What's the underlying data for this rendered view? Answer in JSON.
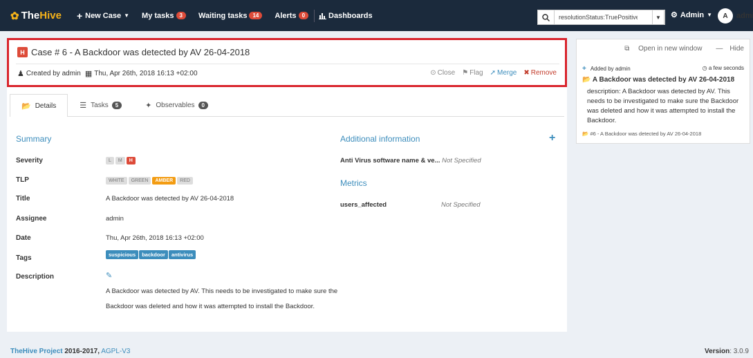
{
  "nav": {
    "brand_the": "The",
    "brand_hive": "Hive",
    "new_case": "New Case",
    "my_tasks": "My tasks",
    "my_tasks_count": "3",
    "waiting_tasks": "Waiting tasks",
    "waiting_tasks_count": "14",
    "alerts": "Alerts",
    "alerts_count": "0",
    "dashboards": "Dashboards",
    "search_value": "resolutionStatus:TruePositive",
    "admin": "Admin",
    "user_initial": "A",
    "user_name": "admin"
  },
  "case": {
    "severity_badge": "H",
    "title": "Case # 6 - A Backdoor was detected by AV 26-04-2018",
    "created_by": "Created by admin",
    "created_at": "Thu, Apr 26th, 2018 16:13 +02:00",
    "actions": {
      "close": "Close",
      "flag": "Flag",
      "merge": "Merge",
      "remove": "Remove"
    }
  },
  "tabs": [
    {
      "label": "Details"
    },
    {
      "label": "Tasks",
      "count": "5"
    },
    {
      "label": "Observables",
      "count": "0"
    }
  ],
  "summary": {
    "title": "Summary",
    "severity_label": "Severity",
    "severity_options": [
      "L",
      "M",
      "H"
    ],
    "severity_selected": "H",
    "tlp_label": "TLP",
    "tlp_options": [
      "WHITE",
      "GREEN",
      "AMBER",
      "RED"
    ],
    "tlp_selected": "AMBER",
    "title_label": "Title",
    "title_value": "A Backdoor was detected by AV 26-04-2018",
    "assignee_label": "Assignee",
    "assignee_value": "admin",
    "date_label": "Date",
    "date_value": "Thu, Apr 26th, 2018 16:13 +02:00",
    "tags_label": "Tags",
    "tags": [
      "suspicious",
      "backdoor",
      "antivirus"
    ],
    "description_label": "Description",
    "description_value": "A Backdoor was detected by AV. This needs to be investigated to make sure the Backdoor was deleted and how it was attempted to install the Backdoor."
  },
  "additional": {
    "title": "Additional information",
    "av_label": "Anti Virus software name & ve...",
    "av_value": "Not Specified",
    "metrics_title": "Metrics",
    "users_affected_label": "users_affected",
    "users_affected_value": "Not Specified"
  },
  "side": {
    "open_new_window": "Open in new window",
    "hide": "Hide",
    "added_by": "Added by admin",
    "time": "a few seconds",
    "title": "A Backdoor was detected by AV 26-04-2018",
    "description": "description: A Backdoor was detected by AV. This needs to be investigated to make sure the Backdoor was deleted and how it was attempted to install the Backdoor.",
    "case_link": "#6 - A Backdoor was detected by AV 26-04-2018"
  },
  "footer": {
    "project": "TheHive Project",
    "years": "2016-2017,",
    "license": "AGPL-V3",
    "version_label": "Version",
    "version": ": 3.0.9"
  },
  "colors": {
    "navbar": "#1b2a3c",
    "brand_accent": "#f5b21a",
    "link": "#3c8dbc",
    "danger": "#dd4b39",
    "amber": "#f39c12",
    "highlight_border": "#d9232b"
  }
}
